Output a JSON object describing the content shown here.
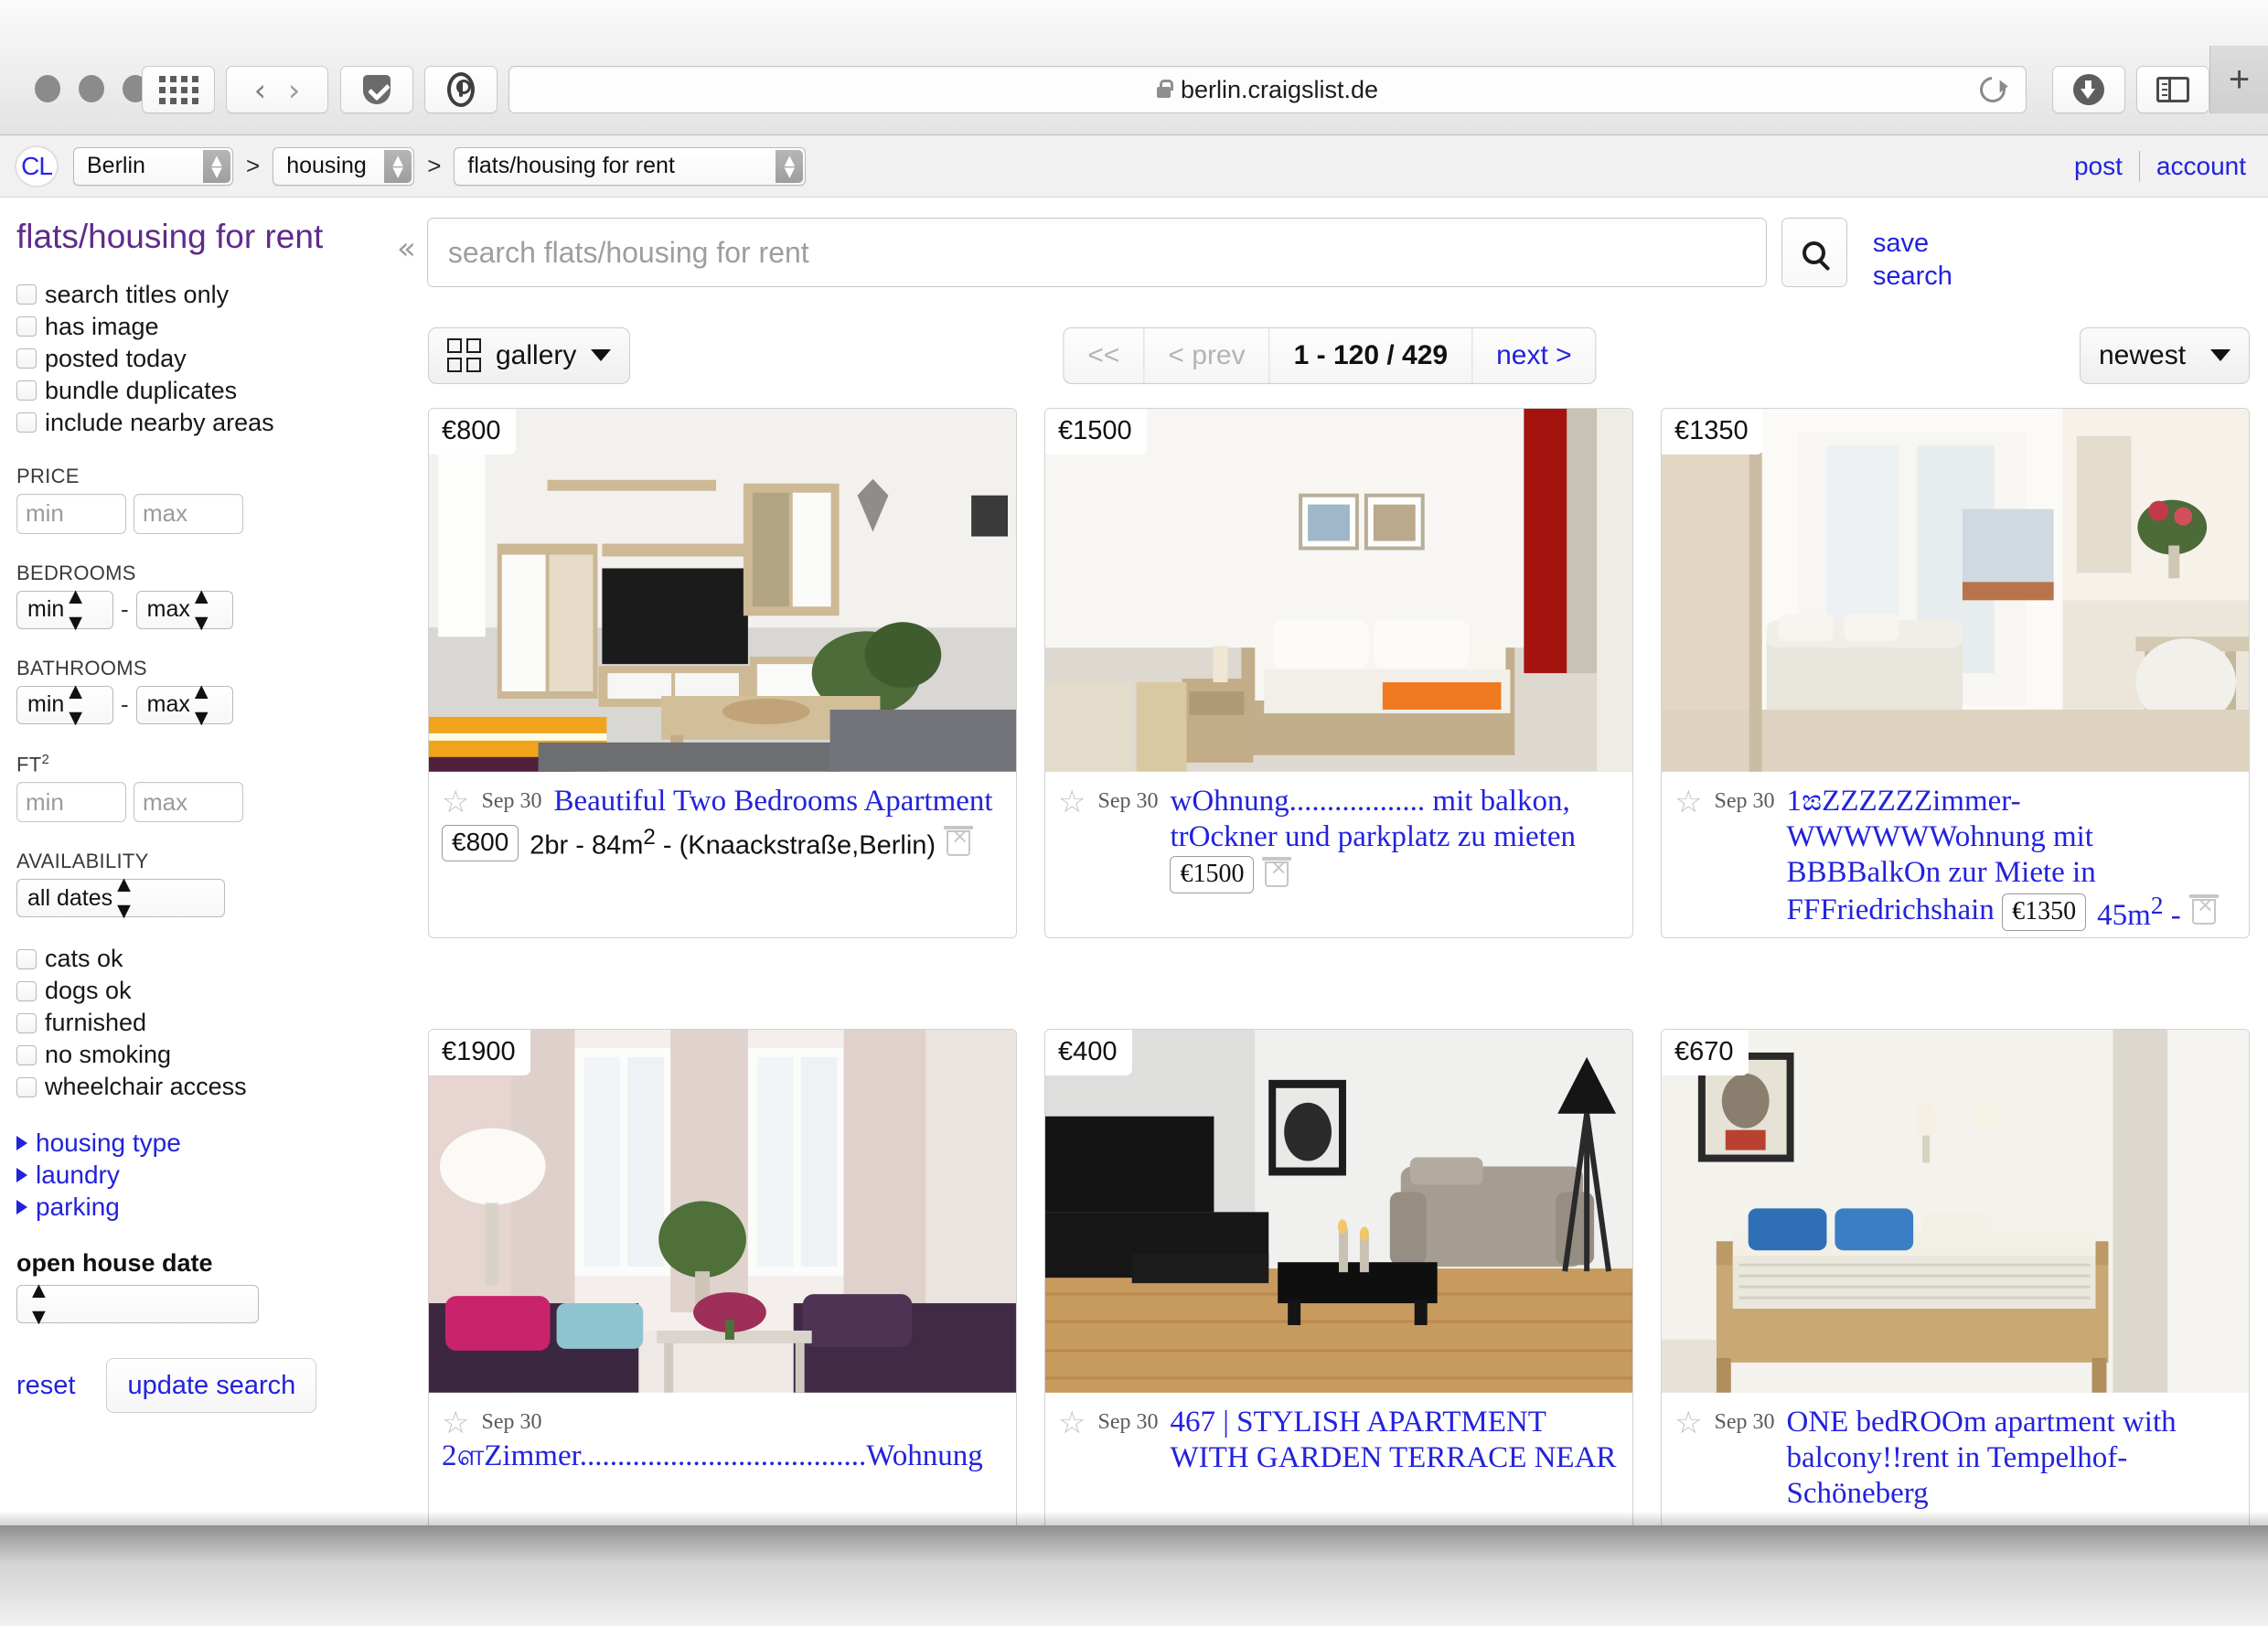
{
  "browser": {
    "url": "berlin.craigslist.de",
    "icons": {
      "grid": "grid-icon",
      "back": "back-chevron-icon",
      "forward": "forward-chevron-icon",
      "pocket": "pocket-icon",
      "privacy": "privacy-report-icon",
      "reload": "reload-icon",
      "lock": "lock-icon",
      "download": "downloads-icon",
      "sidebar": "sidebar-icon",
      "newtab": "+"
    }
  },
  "cl_header": {
    "logo": "CL",
    "city": "Berlin",
    "category": "housing",
    "subcategory": "flats/housing for rent",
    "separator": ">",
    "post_label": "post",
    "account_label": "account"
  },
  "sidebar": {
    "title": "flats/housing for rent",
    "checkboxes": [
      {
        "label": "search titles only",
        "checked": false
      },
      {
        "label": "has image",
        "checked": false
      },
      {
        "label": "posted today",
        "checked": false
      },
      {
        "label": "bundle duplicates",
        "checked": false
      },
      {
        "label": "include nearby areas",
        "checked": false
      }
    ],
    "price": {
      "label": "PRICE",
      "min_placeholder": "min",
      "max_placeholder": "max",
      "min_value": "",
      "max_value": ""
    },
    "bedrooms": {
      "label": "BEDROOMS",
      "min": "min",
      "max": "max"
    },
    "bathrooms": {
      "label": "BATHROOMS",
      "min": "min",
      "max": "max"
    },
    "ft2": {
      "label": "FT",
      "sup": "2",
      "min_placeholder": "min",
      "max_placeholder": "max"
    },
    "availability": {
      "label": "AVAILABILITY",
      "value": "all dates"
    },
    "amenities": [
      {
        "label": "cats ok",
        "checked": false
      },
      {
        "label": "dogs ok",
        "checked": false
      },
      {
        "label": "furnished",
        "checked": false
      },
      {
        "label": "no smoking",
        "checked": false
      },
      {
        "label": "wheelchair access",
        "checked": false
      }
    ],
    "expanders": [
      {
        "label": "housing type"
      },
      {
        "label": "laundry"
      },
      {
        "label": "parking"
      }
    ],
    "open_house": {
      "label": "open house date",
      "value": ""
    },
    "reset_label": "reset",
    "update_label": "update search"
  },
  "search": {
    "placeholder": "search flats/housing for rent",
    "value": "",
    "save_search_label": "save\nsearch",
    "save_search_line1": "save",
    "save_search_line2": "search",
    "collapse_icon": "«",
    "search_icon": "search-icon"
  },
  "toolbar": {
    "view_label": "gallery",
    "pager": {
      "first": "<<",
      "prev": "< prev",
      "count": "1 - 120 / 429",
      "next": "next >"
    },
    "sort_value": "newest"
  },
  "listings": [
    {
      "price": "€800",
      "date": "Sep 30",
      "title": "Beautiful Two Bedrooms Apartment",
      "meta_price": "€800",
      "meta_text": "2br - 84m",
      "meta_sup": "2",
      "meta_tail": " - (Knaackstraße,Berlin)",
      "image": "living-room-with-tv-unit"
    },
    {
      "price": "€1500",
      "date": "Sep 30",
      "title": "wOhnung.................. mit balkon, trOckner und parkplatz zu mieten",
      "meta_price": "€1500",
      "meta_text": "",
      "meta_sup": "",
      "meta_tail": "",
      "image": "bedroom-with-red-curtain"
    },
    {
      "price": "€1350",
      "date": "Sep 30",
      "title": "1ಙZZZZZZimmer-WWWWWWohnung mit BBBBalkOn zur Miete in FFFriedrichshain",
      "meta_price": "€1350",
      "meta_text": "45m",
      "meta_sup": "2",
      "meta_tail": " - ",
      "image": "white-curtained-balcony-room"
    },
    {
      "price": "€1900",
      "date": "Sep 30",
      "title": "2ளZimmer......................................Wohnung",
      "meta_price": "",
      "meta_text": "",
      "meta_sup": "",
      "meta_tail": "",
      "image": "pink-living-room-windows"
    },
    {
      "price": "€400",
      "date": "Sep 30",
      "title": "467 | STYLISH APARTMENT WITH GARDEN TERRACE NEAR",
      "meta_price": "",
      "meta_text": "",
      "meta_sup": "",
      "meta_tail": "",
      "image": "grey-sofa-wood-floor-lounge"
    },
    {
      "price": "€670",
      "date": "Sep 30",
      "title": "ONE bedROOm apartment with balcony!!rent in Tempelhof-Schöneberg",
      "meta_price": "",
      "meta_text": "",
      "meta_sup": "",
      "meta_tail": "",
      "image": "bedroom-blue-pillows"
    }
  ],
  "colors": {
    "link": "#2222dd",
    "heading": "#5f2b8c",
    "page_bg": "#ffffff",
    "chrome": "#eeeeee"
  }
}
